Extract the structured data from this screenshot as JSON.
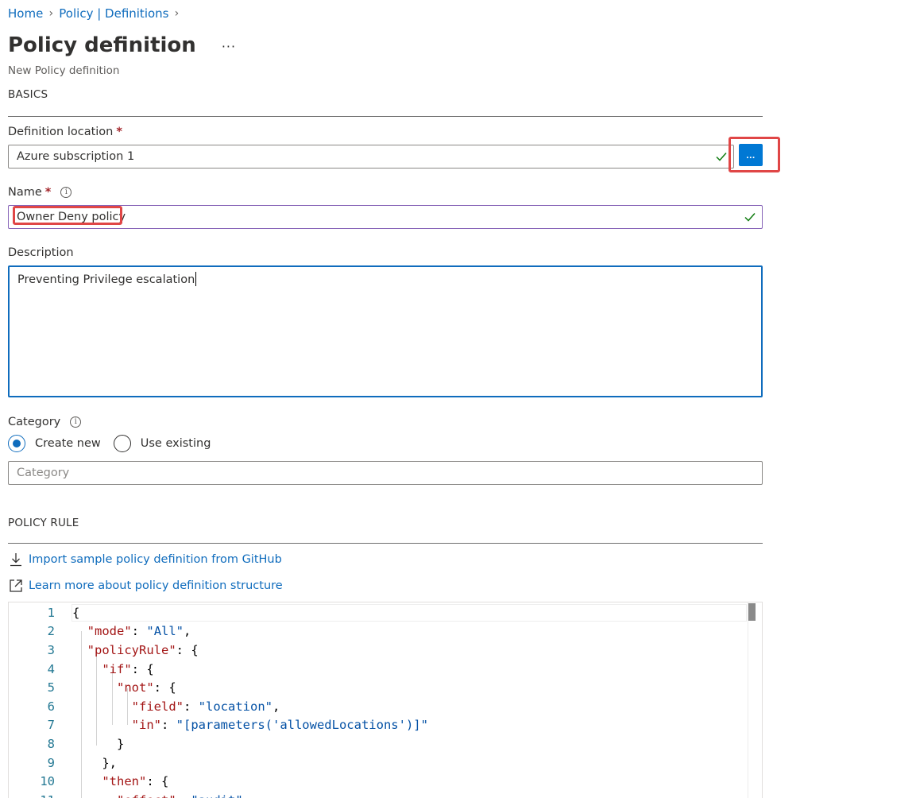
{
  "breadcrumb": {
    "items": [
      "Home",
      "Policy | Definitions"
    ]
  },
  "header": {
    "title": "Policy definition",
    "subtitle": "New Policy definition",
    "more": "···"
  },
  "basics": {
    "heading": "BASICS",
    "definition_location": {
      "label": "Definition location",
      "value": "Azure subscription 1",
      "browse_label": "..."
    },
    "name": {
      "label": "Name",
      "value": "Owner Deny policy"
    },
    "description": {
      "label": "Description",
      "value": "Preventing Privilege escalation"
    },
    "category": {
      "label": "Category",
      "options": [
        "Create new",
        "Use existing"
      ],
      "selected": "Create new",
      "placeholder": "Category"
    },
    "required_mark": "*"
  },
  "policy_rule": {
    "heading": "POLICY RULE",
    "import_link": "Import sample policy definition from GitHub",
    "learn_link": "Learn more about policy definition structure",
    "code_lines": [
      "{",
      "  \"mode\": \"All\",",
      "  \"policyRule\": {",
      "    \"if\": {",
      "      \"not\": {",
      "        \"field\": \"location\",",
      "        \"in\": \"[parameters('allowedLocations')]\"",
      "      }",
      "    },",
      "    \"then\": {",
      "      \"effect\": \"audit\""
    ]
  },
  "colors": {
    "link": "#0f6cbd",
    "primary_button": "#0078d4",
    "highlight": "#e04646",
    "valid_check": "#107c10"
  }
}
